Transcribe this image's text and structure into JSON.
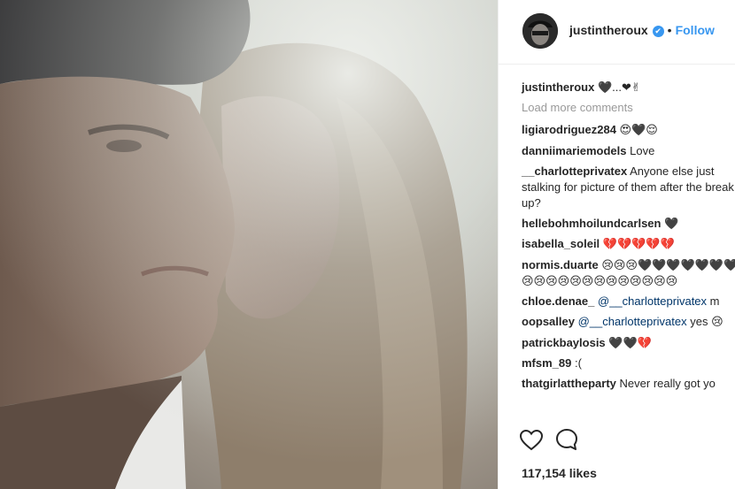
{
  "header": {
    "username": "justintheroux",
    "separator": "•",
    "follow_label": "Follow",
    "verified_mark": "✔"
  },
  "caption": {
    "user": "justintheroux",
    "text": "🖤...❤✌"
  },
  "load_more": "Load more comments",
  "comments": [
    {
      "user": "ligiarodriguez284",
      "text": "😍🖤😌"
    },
    {
      "user": "danniimariemodels",
      "text": "Love"
    },
    {
      "user": "__charlotteprivatex",
      "text": "Anyone else just stalking for picture of them after the break up?"
    },
    {
      "user": "hellebohmhoilundcarlsen",
      "text": "🖤"
    },
    {
      "user": "isabella_soleil",
      "text": "💔💔💔💔💔"
    },
    {
      "user": "normis.duarte",
      "text": "😢😢😢🖤🖤🖤🖤🖤🖤🖤 😢😢😢😢😢😢😢😢😢😢😢😢😢"
    },
    {
      "user": "chloe.denae_",
      "mention": "@__charlotteprivatex",
      "text": "m"
    },
    {
      "user": "oopsalley",
      "mention": "@__charlotteprivatex",
      "text": "yes 😢"
    },
    {
      "user": "patrickbaylosis",
      "text": "🖤🖤💔"
    },
    {
      "user": "mfsm_89",
      "text": ":("
    },
    {
      "user": "thatgirlattheparty",
      "text": "Never really got yo"
    }
  ],
  "likes": "117,154 likes",
  "icons": {
    "like": "heart-outline-icon",
    "comment": "comment-bubble-icon",
    "verified": "verified-badge-icon"
  },
  "colors": {
    "link_blue": "#3897f0",
    "mention_blue": "#003569",
    "muted_gray": "#999999",
    "text": "#262626"
  }
}
